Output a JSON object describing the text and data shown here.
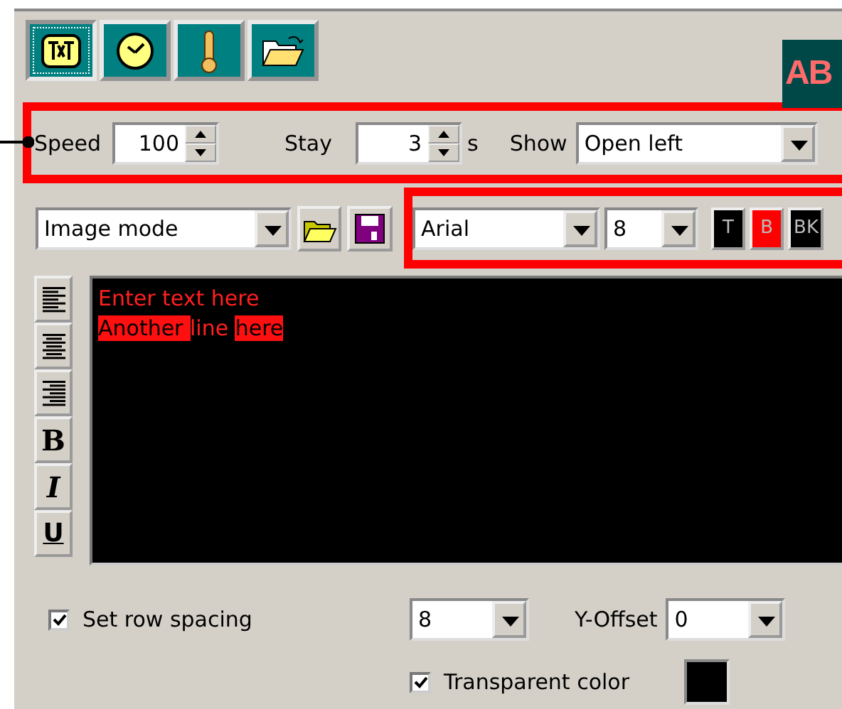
{
  "toolbar": {
    "buttons": [
      {
        "kind": "text",
        "selected": true
      },
      {
        "kind": "clock",
        "selected": false
      },
      {
        "kind": "thermometer",
        "selected": false
      },
      {
        "kind": "open",
        "selected": false
      }
    ]
  },
  "preview": {
    "text": "AB"
  },
  "timing": {
    "speed_label": "Speed",
    "speed": "100",
    "stay_label": "Stay",
    "stay": "3",
    "stay_unit": "s",
    "show_label": "Show",
    "show": "Open left"
  },
  "file_row": {
    "mode": "Image mode"
  },
  "font": {
    "family": "Arial",
    "size": "8",
    "buttons": [
      {
        "label": "T",
        "color": "#000000"
      },
      {
        "label": "B",
        "color": "#ff0000"
      },
      {
        "label": "BK",
        "color": "#000000"
      }
    ]
  },
  "format_buttons": [
    {
      "kind": "align-left"
    },
    {
      "kind": "align-center"
    },
    {
      "kind": "align-right"
    },
    {
      "kind": "bold",
      "label": "B"
    },
    {
      "kind": "italic",
      "label": "I"
    },
    {
      "kind": "underline",
      "label": "U"
    }
  ],
  "editor": {
    "lines": [
      [
        {
          "text": "Enter text here",
          "highlight": false
        }
      ],
      [
        {
          "text": "Another ",
          "highlight": true
        },
        {
          "text": "line ",
          "highlight": false
        },
        {
          "text": "here",
          "highlight": true
        }
      ]
    ]
  },
  "row_spacing": {
    "label": "Set row spacing",
    "checked": true,
    "value": "8"
  },
  "y_offset": {
    "label": "Y-Offset",
    "value": "0"
  },
  "transparent": {
    "label": "Transparent color",
    "checked": true,
    "color": "#000000"
  }
}
